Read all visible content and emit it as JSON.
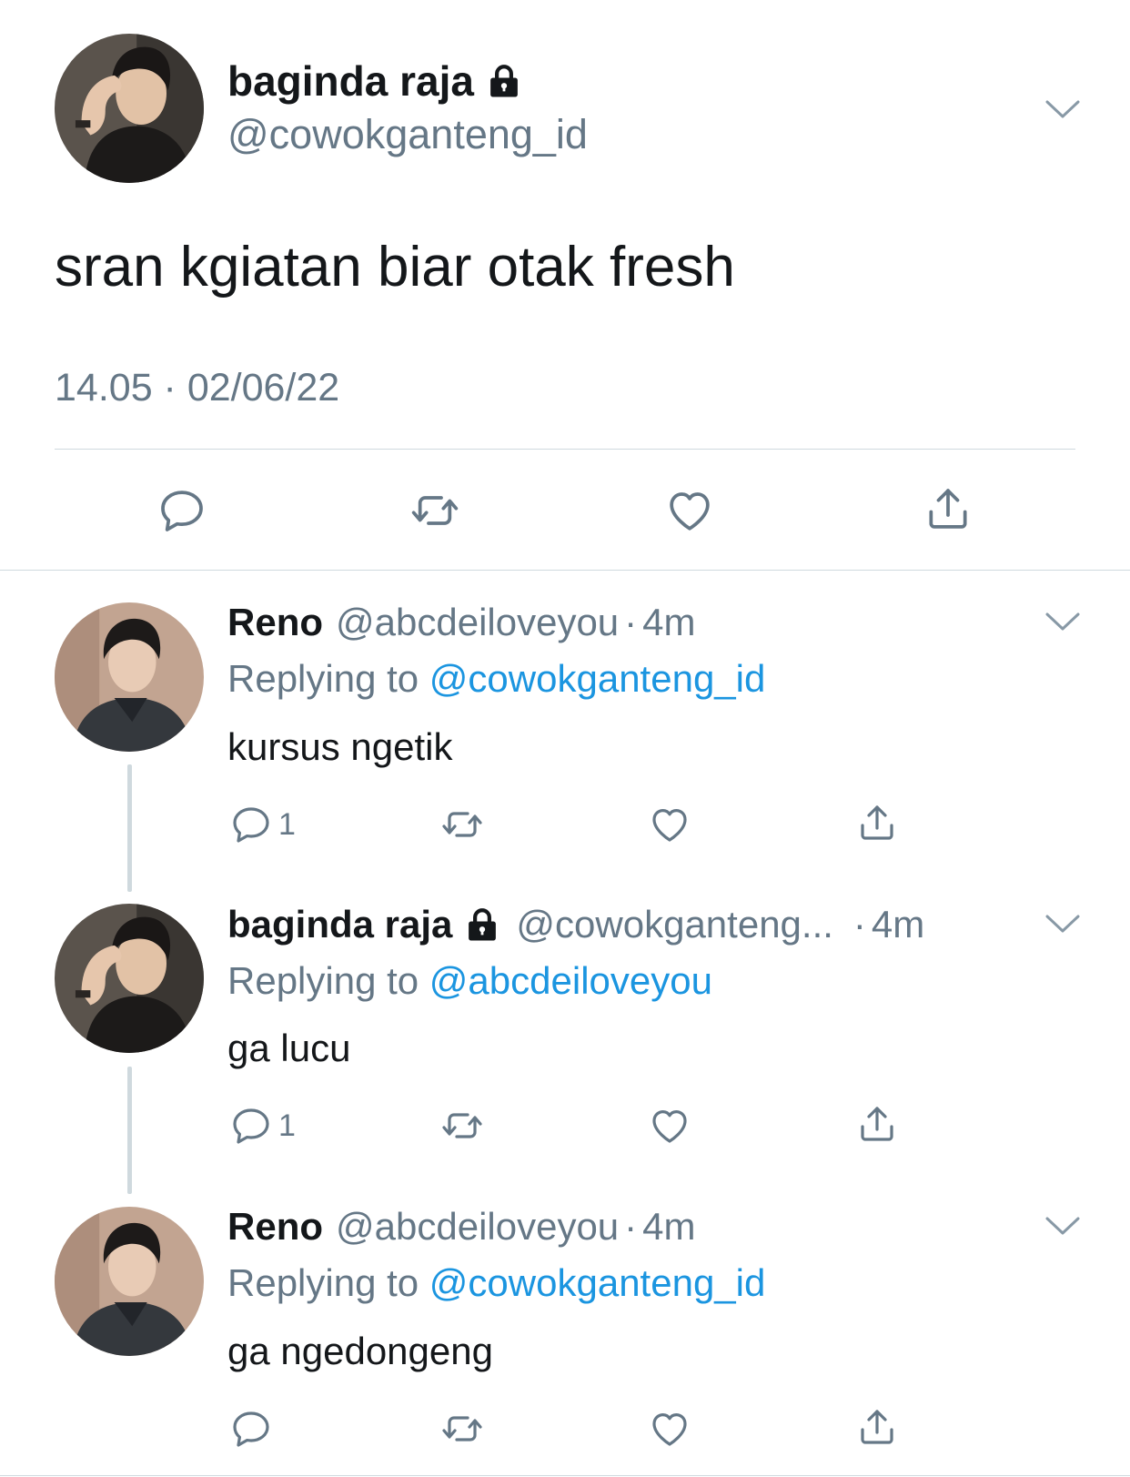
{
  "main_tweet": {
    "author_name": "baginda raja",
    "author_handle": "@cowokganteng_id",
    "text": "sran kgiatan biar otak fresh",
    "timestamp": "14.05 · 02/06/22",
    "icons": {
      "protected": "lock-icon",
      "menu": "chevron-down-icon",
      "reply": "reply-icon",
      "retweet": "retweet-icon",
      "like": "heart-icon",
      "share": "share-icon"
    }
  },
  "replies": [
    {
      "author_name": "Reno",
      "author_handle": "@abcdeiloveyou",
      "time": "4m",
      "replying_prefix": "Replying to",
      "replying_to": "@cowokganteng_id",
      "text": "kursus ngetik",
      "reply_count": "1"
    },
    {
      "author_name": "baginda raja",
      "author_handle": "@cowokganteng...",
      "time": "4m",
      "replying_prefix": "Replying to",
      "replying_to": "@abcdeiloveyou",
      "text": "ga lucu",
      "reply_count": "1"
    },
    {
      "author_name": "Reno",
      "author_handle": "@abcdeiloveyou",
      "time": "4m",
      "replying_prefix": "Replying to",
      "replying_to": "@cowokganteng_id",
      "text": "ga ngedongeng",
      "reply_count": ""
    }
  ],
  "colors": {
    "text": "#14171a",
    "secondary": "#657786",
    "link": "#1b95e0",
    "divider": "#cfd9de"
  }
}
